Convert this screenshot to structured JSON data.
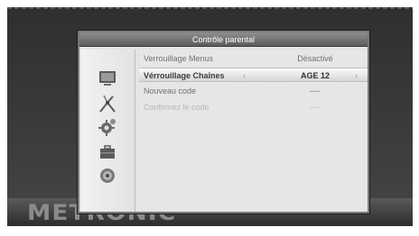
{
  "brand": {
    "logo": "METRONIC"
  },
  "dialog": {
    "title": "Contrôle parental",
    "rows": [
      {
        "label": "Verrouillage Menus",
        "value": "Désactivé"
      },
      {
        "label": "Vérrouillage Chaînes",
        "value": "AGE 12",
        "arrow_left": "‹",
        "arrow_right": "›"
      },
      {
        "label": "Nouveau code",
        "value": "----"
      },
      {
        "label": "Confirmez le code",
        "value": "----"
      }
    ]
  },
  "sidebar_icons": [
    "tv-icon",
    "antenna-icon",
    "settings-gear-icon",
    "toolbox-icon",
    "disc-icon"
  ]
}
